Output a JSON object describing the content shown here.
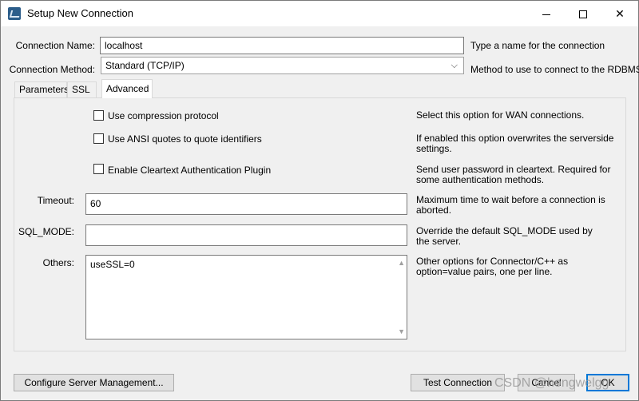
{
  "window": {
    "title": "Setup New Connection"
  },
  "connection": {
    "name_label": "Connection Name:",
    "name_value": "localhost",
    "name_hint": "Type a name for the connection",
    "method_label": "Connection Method:",
    "method_value": "Standard (TCP/IP)",
    "method_hint": "Method to use to connect to the RDBMS"
  },
  "tabs": [
    {
      "label": "Parameters"
    },
    {
      "label": "SSL"
    },
    {
      "label": "Advanced",
      "active": true
    }
  ],
  "advanced": {
    "options": [
      {
        "label": "Use compression protocol",
        "checked": false,
        "desc": "Select this option for WAN connections."
      },
      {
        "label": "Use ANSI quotes to quote identifiers",
        "checked": false,
        "desc": "If enabled this option overwrites the serverside settings."
      },
      {
        "label": "Enable Cleartext Authentication Plugin",
        "checked": false,
        "desc": "Send user password in cleartext. Required for some authentication methods."
      }
    ],
    "timeout": {
      "label": "Timeout:",
      "value": "60",
      "desc": "Maximum time to wait before a connection is aborted."
    },
    "sql_mode": {
      "label": "SQL_MODE:",
      "value": "",
      "desc": "Override the default SQL_MODE used by the server."
    },
    "others": {
      "label": "Others:",
      "value": "useSSL=0",
      "desc": "Other options for Connector/C++ as option=value pairs, one per line."
    }
  },
  "footer": {
    "configure_label": "Configure Server Management...",
    "test_label": "Test Connection",
    "cancel_label": "Cancel",
    "ok_label": "OK"
  },
  "watermark": "CSDN @hongwelgg",
  "colors": {
    "window_bg": "#f0f0f0",
    "accent": "#0078d7"
  }
}
